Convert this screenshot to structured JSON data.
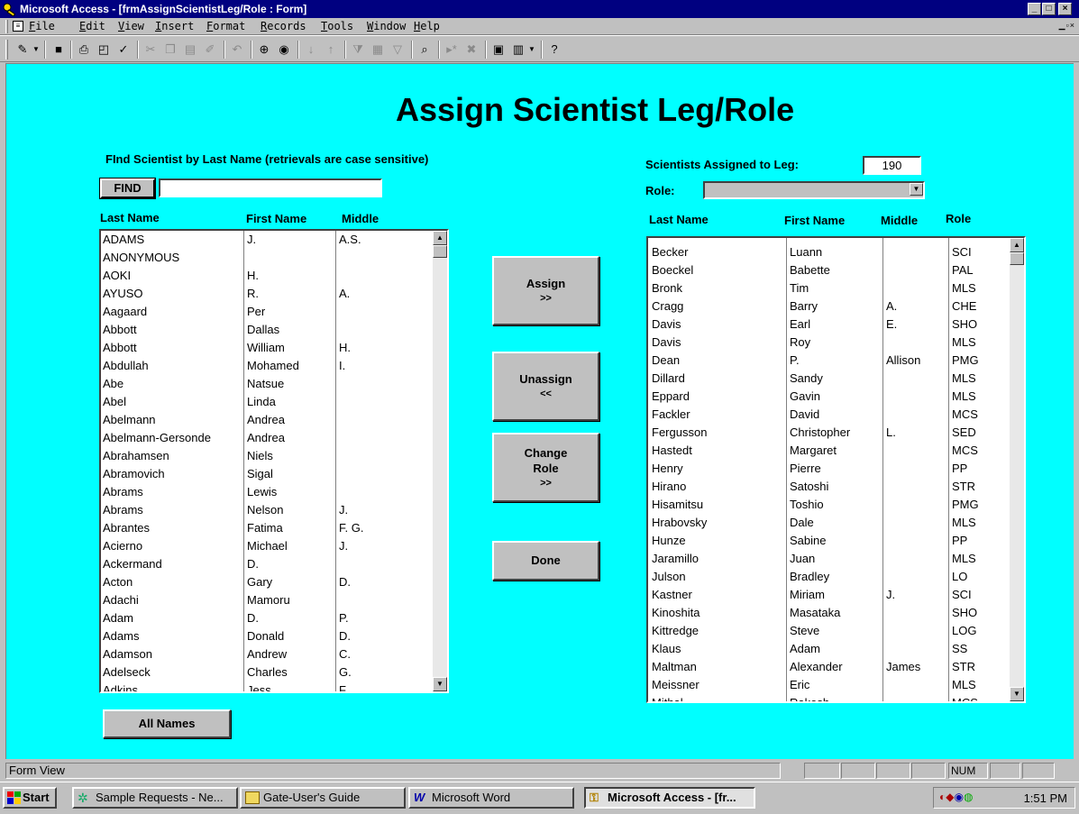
{
  "window": {
    "title": "Microsoft Access - [frmAssignScientistLeg/Role : Form]"
  },
  "menu": [
    "File",
    "Edit",
    "View",
    "Insert",
    "Format",
    "Records",
    "Tools",
    "Window",
    "Help"
  ],
  "form": {
    "title": "Assign Scientist Leg/Role",
    "find_label": "FInd Scientist by Last Name (retrievals are case sensitive)",
    "find_button": "FIND",
    "find_value": "",
    "left_headers": {
      "last": "Last Name",
      "first": "First Name",
      "middle": "Middle"
    },
    "all_names_button": "All Names",
    "assigned_label": "Scientists Assigned to Leg:",
    "assigned_value": "190",
    "role_label": "Role:",
    "role_value": "",
    "right_headers": {
      "last": "Last Name",
      "first": "First Name",
      "middle": "Middle",
      "role": "Role"
    },
    "buttons": {
      "assign": {
        "line1": "Assign",
        "line2": ">>"
      },
      "unassign": {
        "line1": "Unassign",
        "line2": "<<"
      },
      "change_role": {
        "line1": "Change",
        "line2": "Role",
        "line3": ">>"
      },
      "done": {
        "line1": "Done"
      }
    }
  },
  "all_scientists": [
    {
      "last": "ADAMS",
      "first": "J.",
      "middle": "A.S."
    },
    {
      "last": "ANONYMOUS",
      "first": "",
      "middle": ""
    },
    {
      "last": "AOKI",
      "first": "H.",
      "middle": ""
    },
    {
      "last": "AYUSO",
      "first": "R.",
      "middle": "A."
    },
    {
      "last": "Aagaard",
      "first": "Per",
      "middle": ""
    },
    {
      "last": "Abbott",
      "first": "Dallas",
      "middle": ""
    },
    {
      "last": "Abbott",
      "first": "William",
      "middle": "H."
    },
    {
      "last": "Abdullah",
      "first": "Mohamed",
      "middle": "I."
    },
    {
      "last": "Abe",
      "first": "Natsue",
      "middle": ""
    },
    {
      "last": "Abel",
      "first": "Linda",
      "middle": ""
    },
    {
      "last": "Abelmann",
      "first": "Andrea",
      "middle": ""
    },
    {
      "last": "Abelmann-Gersonde",
      "first": "Andrea",
      "middle": ""
    },
    {
      "last": "Abrahamsen",
      "first": "Niels",
      "middle": ""
    },
    {
      "last": "Abramovich",
      "first": "Sigal",
      "middle": ""
    },
    {
      "last": "Abrams",
      "first": "Lewis",
      "middle": ""
    },
    {
      "last": "Abrams",
      "first": "Nelson",
      "middle": "J."
    },
    {
      "last": "Abrantes",
      "first": "Fatima",
      "middle": "F. G."
    },
    {
      "last": "Acierno",
      "first": "Michael",
      "middle": "J."
    },
    {
      "last": "Ackermand",
      "first": "D.",
      "middle": ""
    },
    {
      "last": "Acton",
      "first": "Gary",
      "middle": "D."
    },
    {
      "last": "Adachi",
      "first": "Mamoru",
      "middle": ""
    },
    {
      "last": "Adam",
      "first": "D.",
      "middle": "P."
    },
    {
      "last": "Adams",
      "first": "Donald",
      "middle": "D."
    },
    {
      "last": "Adamson",
      "first": "Andrew",
      "middle": "C."
    },
    {
      "last": "Adelseck",
      "first": "Charles",
      "middle": "G."
    },
    {
      "last": "Adkins",
      "first": "Jess",
      "middle": "F."
    }
  ],
  "assigned_scientists": [
    {
      "last": "Becker",
      "first": "Luann",
      "middle": "",
      "role": "SCI"
    },
    {
      "last": "Boeckel",
      "first": "Babette",
      "middle": "",
      "role": "PAL"
    },
    {
      "last": "Bronk",
      "first": "Tim",
      "middle": "",
      "role": "MLS"
    },
    {
      "last": "Cragg",
      "first": "Barry",
      "middle": "A.",
      "role": "CHE"
    },
    {
      "last": "Davis",
      "first": "Earl",
      "middle": "E.",
      "role": "SHO"
    },
    {
      "last": "Davis",
      "first": "Roy",
      "middle": "",
      "role": "MLS"
    },
    {
      "last": "Dean",
      "first": "P.",
      "middle": "Allison",
      "role": "PMG"
    },
    {
      "last": "Dillard",
      "first": "Sandy",
      "middle": "",
      "role": "MLS"
    },
    {
      "last": "Eppard",
      "first": "Gavin",
      "middle": "",
      "role": "MLS"
    },
    {
      "last": "Fackler",
      "first": "David",
      "middle": "",
      "role": "MCS"
    },
    {
      "last": "Fergusson",
      "first": "Christopher",
      "middle": "L.",
      "role": "SED"
    },
    {
      "last": "Hastedt",
      "first": "Margaret",
      "middle": "",
      "role": "MCS"
    },
    {
      "last": "Henry",
      "first": "Pierre",
      "middle": "",
      "role": "PP"
    },
    {
      "last": "Hirano",
      "first": "Satoshi",
      "middle": "",
      "role": "STR"
    },
    {
      "last": "Hisamitsu",
      "first": "Toshio",
      "middle": "",
      "role": "PMG"
    },
    {
      "last": "Hrabovsky",
      "first": "Dale",
      "middle": "",
      "role": "MLS"
    },
    {
      "last": "Hunze",
      "first": "Sabine",
      "middle": "",
      "role": "PP"
    },
    {
      "last": "Jaramillo",
      "first": "Juan",
      "middle": "",
      "role": "MLS"
    },
    {
      "last": "Julson",
      "first": "Bradley",
      "middle": "",
      "role": "LO"
    },
    {
      "last": "Kastner",
      "first": "Miriam",
      "middle": "J.",
      "role": "SCI"
    },
    {
      "last": "Kinoshita",
      "first": "Masataka",
      "middle": "",
      "role": "SHO"
    },
    {
      "last": "Kittredge",
      "first": "Steve",
      "middle": "",
      "role": "LOG"
    },
    {
      "last": "Klaus",
      "first": "Adam",
      "middle": "",
      "role": "SS"
    },
    {
      "last": "Maltman",
      "first": "Alexander",
      "middle": "James",
      "role": "STR"
    },
    {
      "last": "Meissner",
      "first": "Eric",
      "middle": "",
      "role": "MLS"
    },
    {
      "last": "Mithal",
      "first": "Rakesh",
      "middle": "",
      "role": "MCS"
    }
  ],
  "statusbar": {
    "text": "Form View",
    "num": "NUM"
  },
  "taskbar": {
    "start": "Start",
    "tasks": [
      "Sample Requests - Ne...",
      "Gate-User's Guide",
      "Microsoft Word",
      "Microsoft Access - [fr..."
    ],
    "clock": "1:51 PM"
  },
  "colors": {
    "form_bg": "#00ffff",
    "titlebar": "#000080",
    "chrome": "#c0c0c0"
  }
}
